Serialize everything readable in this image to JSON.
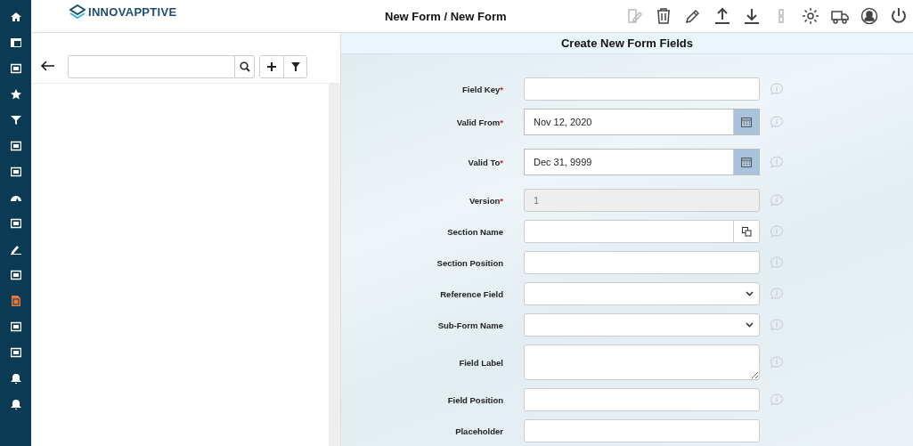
{
  "sidebar": {
    "items": [
      {
        "selected": false
      },
      {
        "selected": false
      },
      {
        "selected": false
      },
      {
        "selected": false
      },
      {
        "selected": false
      },
      {
        "selected": false
      },
      {
        "selected": false
      },
      {
        "selected": false
      },
      {
        "selected": false
      },
      {
        "selected": false
      },
      {
        "selected": false
      },
      {
        "selected": true
      },
      {
        "selected": false
      },
      {
        "selected": false
      },
      {
        "selected": false
      },
      {
        "selected": false
      }
    ]
  },
  "header": {
    "logo": "INNOVAPPTIVE",
    "title": "New Form / New Form",
    "toolbar": [
      {
        "disabled": true
      },
      {
        "disabled": false
      },
      {
        "disabled": false
      },
      {
        "disabled": false
      },
      {
        "disabled": false
      },
      {
        "disabled": true
      },
      {
        "disabled": false
      },
      {
        "disabled": false
      },
      {
        "disabled": false
      },
      {
        "disabled": false
      }
    ]
  },
  "form": {
    "title": "Create New Form Fields",
    "fields": [
      {
        "label": "Field Key",
        "required_mark": "*",
        "kind": "text",
        "info": true
      },
      {
        "label": "Valid From",
        "required_mark": "*",
        "kind": "date",
        "value": "Nov 12, 2020",
        "info": true
      },
      {
        "label": "Valid To",
        "required_mark": "*",
        "kind": "date",
        "value": "Dec 31, 9999",
        "info": true
      },
      {
        "label": "Version",
        "required_mark": "*",
        "kind": "readonly",
        "value": "1",
        "info": true
      },
      {
        "label": "Section Name",
        "kind": "lookup",
        "info": true
      },
      {
        "label": "Section Position",
        "kind": "text",
        "info": true
      },
      {
        "label": "Reference Field",
        "kind": "select",
        "info": true
      },
      {
        "label": "Sub-Form Name",
        "kind": "select",
        "info": true
      },
      {
        "label": "Field Label",
        "kind": "textarea",
        "info": true
      },
      {
        "label": "Field Position",
        "kind": "text",
        "info": true
      },
      {
        "label": "Placeholder",
        "kind": "text",
        "info": false
      }
    ]
  }
}
